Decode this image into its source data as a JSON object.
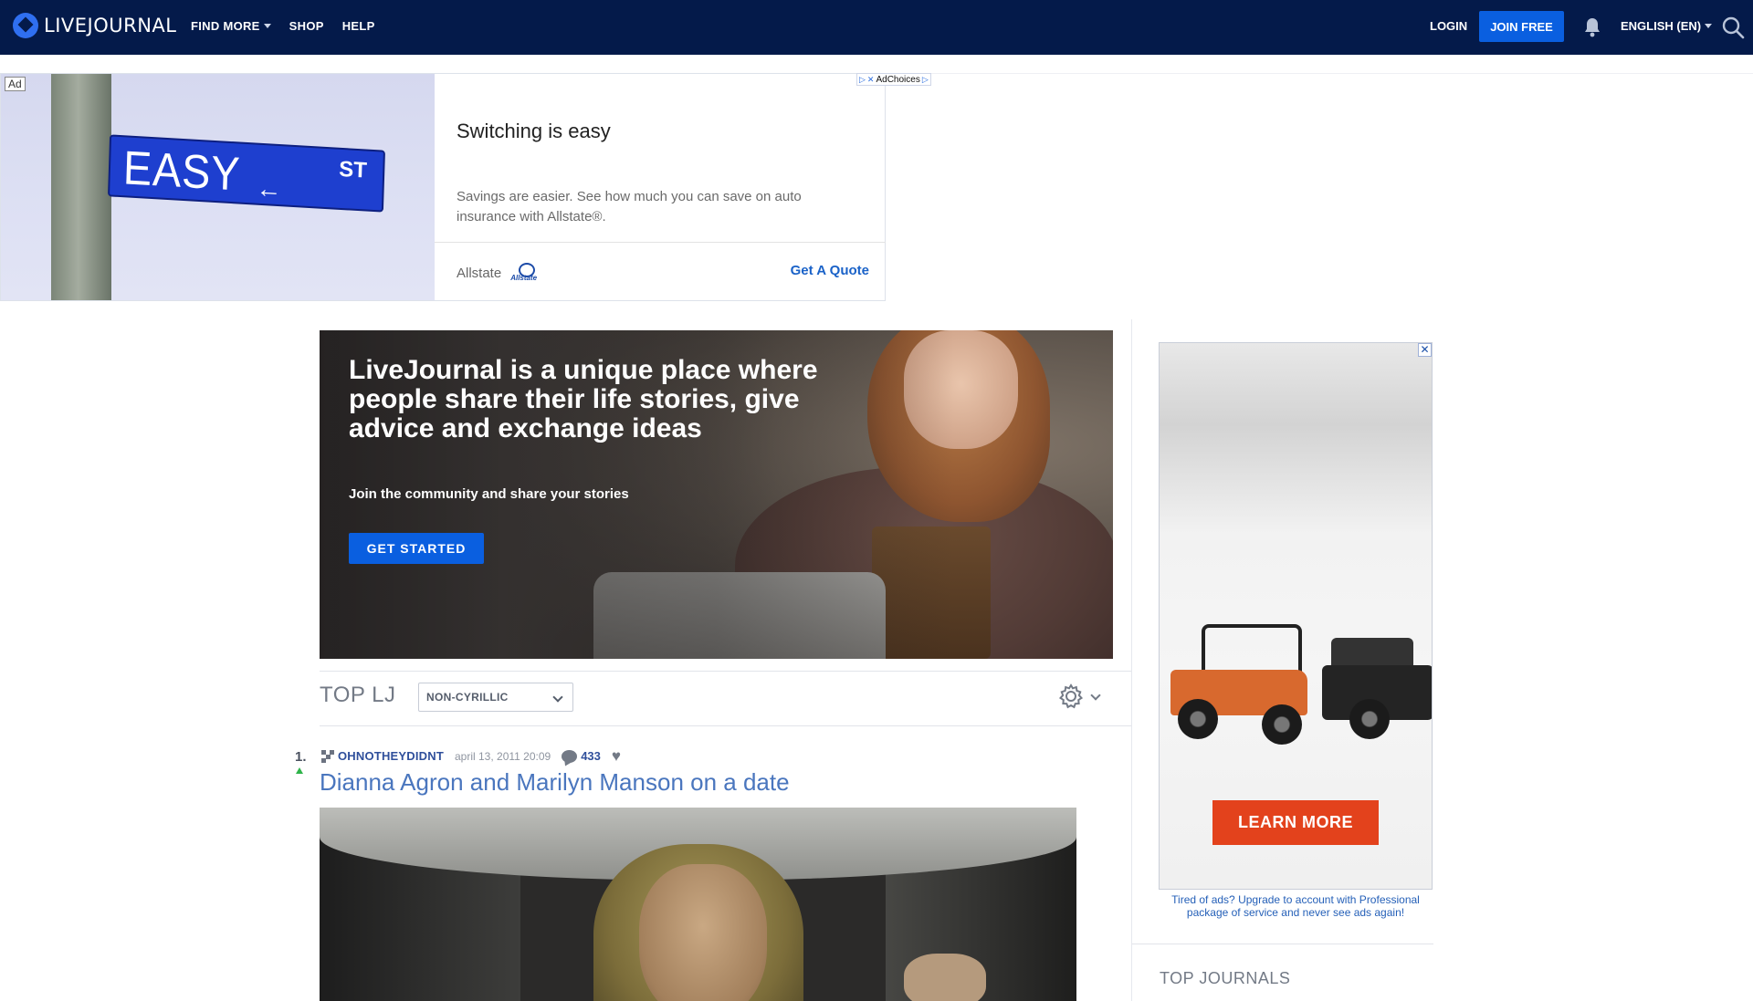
{
  "header": {
    "logo_text": "LIVEJOURNAL",
    "nav": [
      {
        "label": "FIND MORE",
        "has_caret": true
      },
      {
        "label": "SHOP",
        "has_caret": false
      },
      {
        "label": "HELP",
        "has_caret": false
      }
    ],
    "login_label": "LOGIN",
    "join_label": "JOIN FREE",
    "language_label": "ENGLISH (EN)",
    "icons": {
      "bell": "bell-icon",
      "search": "search-icon"
    }
  },
  "top_ad": {
    "ad_label": "Ad",
    "adchoices_label": "AdChoices",
    "sign_text": "EASY",
    "sign_suffix": "ST",
    "headline": "Switching is easy",
    "description": "Savings are easier. See how much you can save on auto insurance with Allstate®.",
    "brand": "Allstate",
    "brand_logo_text": "Allstate",
    "cta": "Get A Quote"
  },
  "hero": {
    "title": "LiveJournal is a unique place where people share their life stories, give advice and exchange ideas",
    "subtitle": "Join the community and share your stories",
    "button_label": "GET STARTED"
  },
  "top_lj": {
    "title": "TOP LJ",
    "filter_value": "NON-CYRILLIC",
    "icons": {
      "settings": "gear-icon",
      "expand": "chevron-down-icon"
    }
  },
  "posts": [
    {
      "rank": "1.",
      "author": "OHNOTHEYDIDNT",
      "date": "april 13, 2011 20:09",
      "comments": "433",
      "title": "Dianna Agron and Marilyn Manson on a date"
    }
  ],
  "sidebar": {
    "ad_button": "LEARN MORE",
    "ad_close": "✕",
    "ad_note": "Tired of ads? Upgrade to account with Professional package of service and never see ads again!",
    "section_title": "TOP JOURNALS"
  },
  "colors": {
    "header_bg": "#041a4a",
    "accent_blue": "#0a5fe0",
    "link_blue": "#4a76be",
    "ad_cta_red": "#e3421c"
  }
}
